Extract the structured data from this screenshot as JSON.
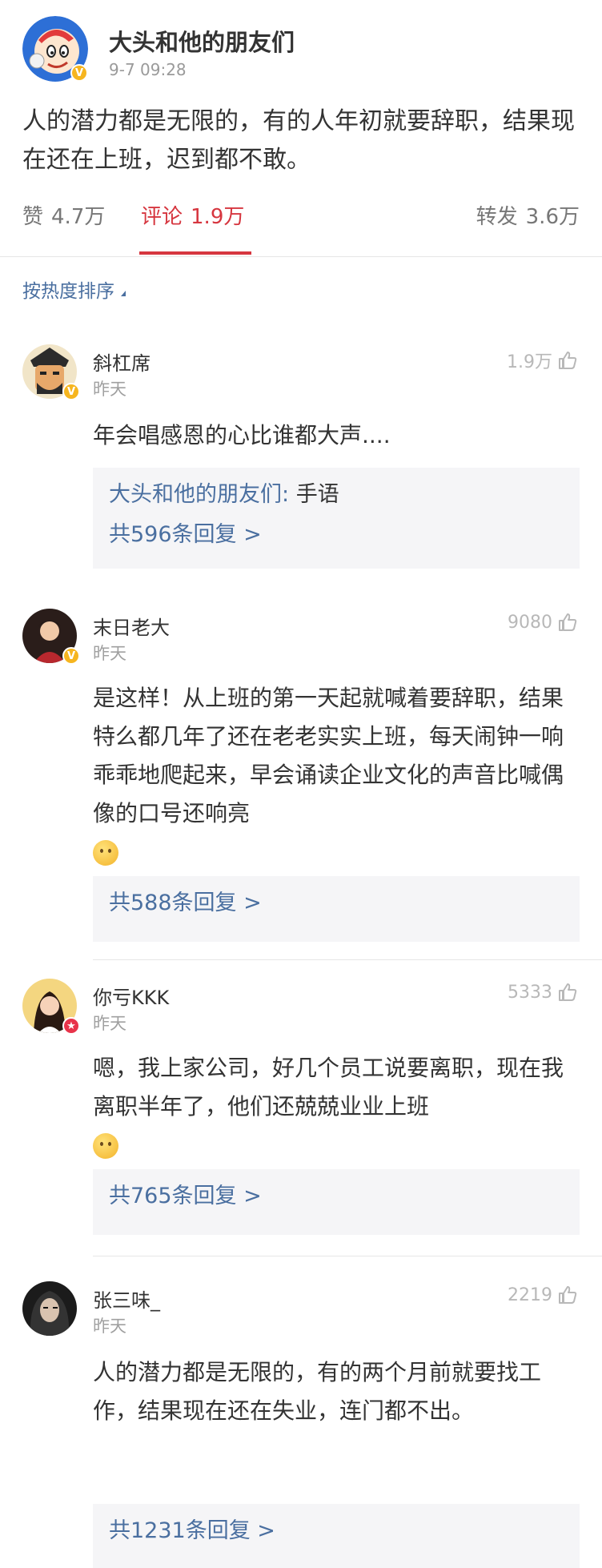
{
  "post": {
    "author": "大头和他的朋友们",
    "time": "9-7 09:28",
    "body": "人的潜力都是无限的，有的人年初就要辞职，结果现在还在上班，迟到都不敢。",
    "avatar_icon": "cartoon-face-avatar",
    "verified_icon": "verified-v-badge"
  },
  "stats": {
    "likes_label": "赞",
    "likes_value": "4.7万",
    "comments_label": "评论",
    "comments_value": "1.9万",
    "reposts_label": "转发",
    "reposts_value": "3.6万"
  },
  "sort_label": "按热度排序",
  "comments": [
    {
      "name": "斜杠席",
      "time": "昨天",
      "likes": "1.9万",
      "text": "年会唱感恩的心比谁都大声....",
      "reply_preview_user": "大头和他的朋友们",
      "reply_preview_text": "手语",
      "reply_count": "共596条回复 >"
    },
    {
      "name": "末日老大",
      "time": "昨天",
      "likes": "9080",
      "text": "是这样！从上班的第一天起就喊着要辞职，结果特么都几年了还在老老实实上班，每天闹钟一响乖乖地爬起来，早会诵读企业文化的声音比喊偶像的口号还响亮",
      "reply_count": "共588条回复 >"
    },
    {
      "name": "你亏KKK",
      "time": "昨天",
      "likes": "5333",
      "text": "嗯，我上家公司，好几个员工说要离职，现在我离职半年了，他们还兢兢业业上班",
      "reply_count": "共765条回复 >"
    },
    {
      "name": "张三味_",
      "time": "昨天",
      "likes": "2219",
      "text": "人的潜力都是无限的，有的两个月前就要找工作，结果现在还在失业，连门都不出。",
      "reply_count": "共1231条回复 >"
    }
  ],
  "colors": {
    "accent": "#d6363f",
    "link": "#4a6fa0",
    "muted": "#9a9a9a"
  }
}
